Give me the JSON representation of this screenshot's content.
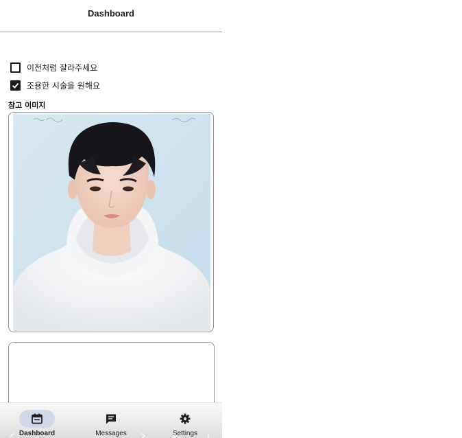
{
  "header": {
    "title": "Dashboard"
  },
  "options": [
    {
      "label": "이전처럼 잘라주세요",
      "checked": false
    },
    {
      "label": "조용한 시술을 원해요",
      "checked": true
    }
  ],
  "reference": {
    "title": "참고 이미지",
    "image_icon": "portrait-photo"
  },
  "nav": {
    "items": [
      {
        "label": "Dashboard",
        "icon": "calendar-icon",
        "active": true
      },
      {
        "label": "Messages",
        "icon": "message-icon",
        "active": false
      },
      {
        "label": "Settings",
        "icon": "gear-icon",
        "active": false
      }
    ]
  },
  "colors": {
    "accent_pill": "#cfd9ea",
    "photo_background": "#cfe4f1",
    "divider": "#9a9a9a"
  }
}
